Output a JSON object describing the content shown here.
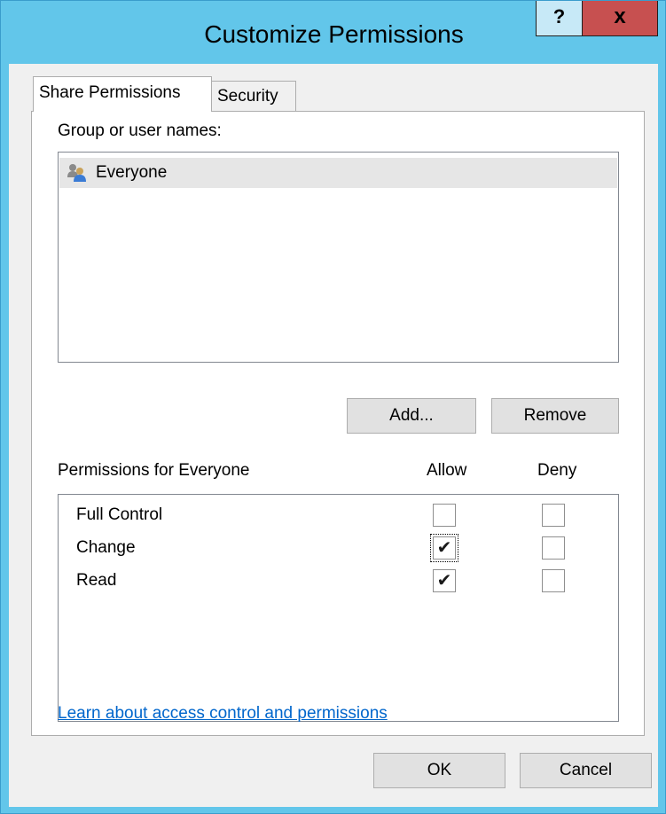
{
  "window": {
    "title": "Customize Permissions",
    "help_label": "?",
    "close_label": "x"
  },
  "tabs": [
    {
      "label": "Share Permissions",
      "active": true
    },
    {
      "label": "Security",
      "active": false
    }
  ],
  "group_section": {
    "label": "Group or user names:",
    "items": [
      {
        "label": "Everyone",
        "icon": "users-icon",
        "selected": true
      }
    ],
    "add_label": "Add...",
    "remove_label": "Remove"
  },
  "permissions": {
    "header": "Permissions for Everyone",
    "allow_header": "Allow",
    "deny_header": "Deny",
    "rows": [
      {
        "name": "Full Control",
        "allow": false,
        "deny": false
      },
      {
        "name": "Change",
        "allow": true,
        "deny": false
      },
      {
        "name": "Read",
        "allow": true,
        "deny": false
      }
    ]
  },
  "link_text": "Learn about access control and permissions",
  "buttons": {
    "ok_label": "OK",
    "cancel_label": "Cancel"
  },
  "colors": {
    "frame": "#62c6ea",
    "close_button": "#c75050",
    "link": "#0066cc",
    "selected_item": "#e6e6e6"
  }
}
